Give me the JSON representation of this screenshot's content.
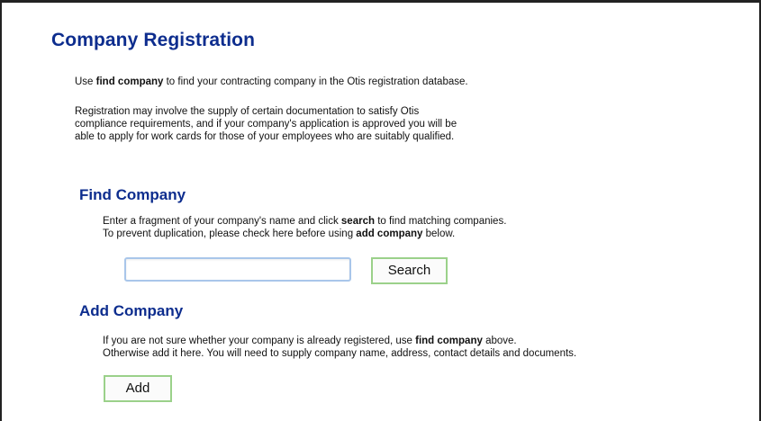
{
  "title": "Company Registration",
  "intro": {
    "p1_before": "Use ",
    "p1_bold": "find company",
    "p1_after": " to find your contracting company in the Otis registration database.",
    "p2_line1": "Registration may involve the supply of certain documentation to satisfy Otis",
    "p2_line2": "compliance requirements, and if your company's application is approved you will be",
    "p2_line3": "able to apply for work cards for those of your employees who are suitably qualified."
  },
  "find": {
    "heading": "Find Company",
    "line1_before": "Enter a fragment of your company's name and click ",
    "line1_bold": "search",
    "line1_after": " to find matching companies.",
    "line2_before": "To prevent duplication, please check here before using ",
    "line2_bold": "add company",
    "line2_after": " below.",
    "input_value": "",
    "search_label": "Search"
  },
  "add": {
    "heading": "Add Company",
    "line1_before": "If you are not sure whether your company is already registered, use ",
    "line1_bold": "find company",
    "line1_after": " above.",
    "line2": "Otherwise add it here. You will need to supply company name, address, contact details and documents.",
    "add_label": "Add"
  },
  "colors": {
    "heading": "#0d2d8e",
    "button_border": "#9bd18a",
    "input_border": "#a9c6ea"
  }
}
